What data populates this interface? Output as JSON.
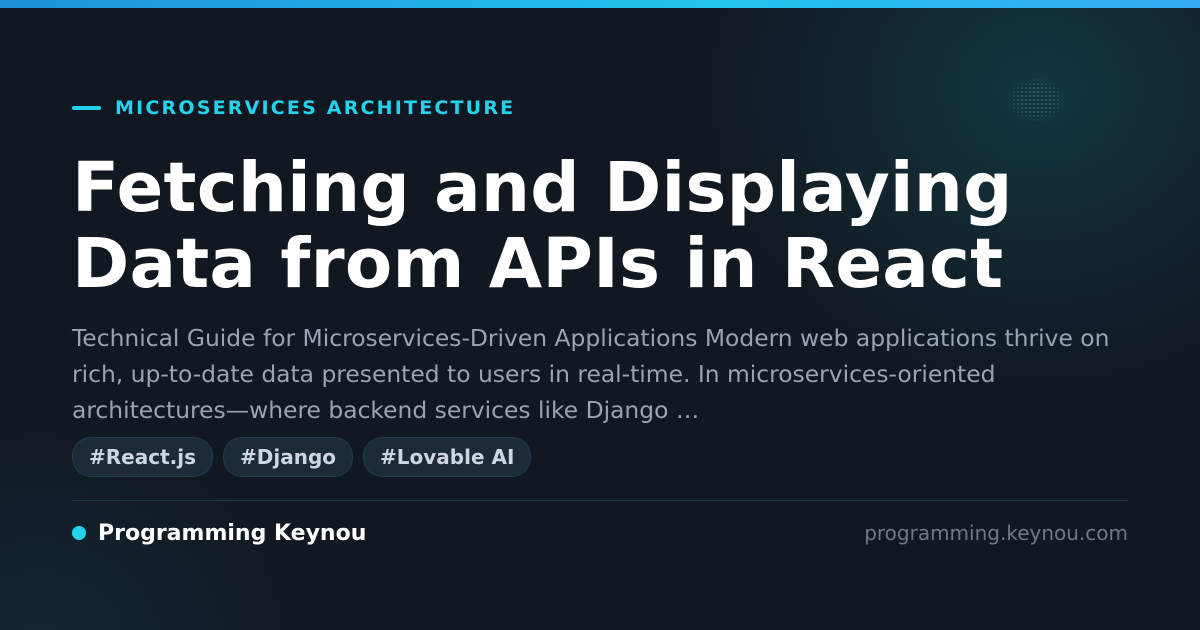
{
  "category": "MICROSERVICES ARCHITECTURE",
  "title_lines": [
    "Fetching and Displaying",
    "Data from APIs in React"
  ],
  "description": "Technical Guide for Microservices-Driven Applications Modern web applications thrive on rich, up-to-date data presented to users in real-time. In microservices-oriented architectures—where backend services like Django …",
  "tags": [
    "#React.js",
    "#Django",
    "#Lovable AI"
  ],
  "brand": {
    "name": "Programming Keynou",
    "url": "programming.keynou.com"
  },
  "colors": {
    "accent": "#22d3ee",
    "background": "#121821",
    "title": "#ffffff",
    "description": "#9aa3b0",
    "tag_background": "#1c2b36",
    "url": "#6f7884"
  }
}
